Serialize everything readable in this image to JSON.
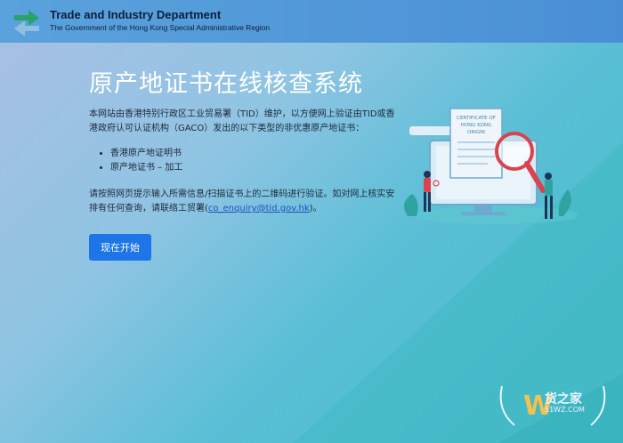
{
  "header": {
    "title": "Trade and Industry Department",
    "subtitle": "The Government of the Hong Kong Special Administrative Region"
  },
  "main": {
    "title": "原产地证书在线核查系统",
    "intro": "本网站由香港特别行政区工业贸易署（TID）维护，以方便网上验证由TID或香港政府认可认证机构（GACO）发出的以下类型的非优惠原产地证书：",
    "cert_types": [
      "香港原产地证明书",
      "原产地证书 – 加工"
    ],
    "instructions_before": "请按照网页提示输入所需信息/扫描证书上的二维码进行验证。如对网上核实安排有任何查询，请联络工贸署(",
    "email": "co_enquiry@tid.gov.hk",
    "instructions_after": ")。",
    "start_button": "现在开始"
  },
  "illustration": {
    "certificate_text": "CERTIFICATE OF HONG KONG ORIGIN"
  },
  "watermark": {
    "logo_letter": "W",
    "text": "货之家",
    "site": "51WZ.COM"
  },
  "colors": {
    "header_bg": "#4a8fd6",
    "button_bg": "#1d75e8",
    "link": "#1d4fc4",
    "logo_green": "#2aa36b"
  }
}
